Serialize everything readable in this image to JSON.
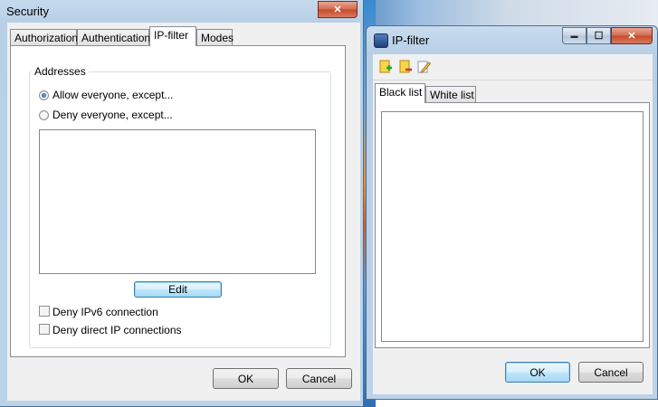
{
  "security_window": {
    "title": "Security",
    "close_label": "✕",
    "tabs": [
      {
        "label": "Authorization"
      },
      {
        "label": "Authentication"
      },
      {
        "label": "IP-filter"
      },
      {
        "label": "Modes"
      }
    ],
    "active_tab": "IP-filter",
    "group_label": "Addresses",
    "radio_allow": "Allow everyone, except...",
    "radio_deny": "Deny everyone, except...",
    "radio_selected": "allow",
    "edit_button": "Edit",
    "check_ipv6": "Deny IPv6 connection",
    "check_direct": "Deny direct IP connections",
    "ok_button": "OK",
    "cancel_button": "Cancel"
  },
  "ipfilter_window": {
    "title": "IP-filter",
    "minimize_label": "▬",
    "maximize_label": "☐",
    "close_label": "✕",
    "toolbar_icons": [
      "add-icon",
      "remove-icon",
      "edit-icon"
    ],
    "tabs": [
      {
        "label": "Black list"
      },
      {
        "label": "White list"
      }
    ],
    "active_tab": "Black list",
    "ok_button": "OK",
    "cancel_button": "Cancel"
  }
}
